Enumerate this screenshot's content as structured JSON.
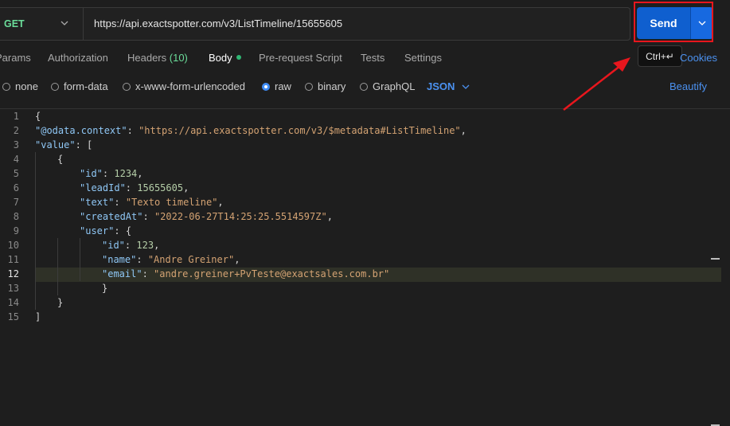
{
  "request": {
    "method": "GET",
    "url": "https://api.exactspotter.com/v3/ListTimeline/15655605",
    "send_label": "Send",
    "send_shortcut": "Ctrl+↵",
    "cookies_label": "Cookies"
  },
  "tabs": [
    {
      "label": "Params"
    },
    {
      "label": "Authorization"
    },
    {
      "label": "Headers",
      "count": "(10)"
    },
    {
      "label": "Body",
      "active": true
    },
    {
      "label": "Pre-request Script"
    },
    {
      "label": "Tests"
    },
    {
      "label": "Settings"
    }
  ],
  "body_types": [
    {
      "label": "none"
    },
    {
      "label": "form-data"
    },
    {
      "label": "x-www-form-urlencoded"
    },
    {
      "label": "raw",
      "selected": true
    },
    {
      "label": "binary"
    },
    {
      "label": "GraphQL"
    }
  ],
  "format_label": "JSON",
  "beautify_label": "Beautify",
  "editor": {
    "line_numbers": [
      "1",
      "2",
      "3",
      "4",
      "5",
      "6",
      "7",
      "8",
      "9",
      "10",
      "11",
      "12",
      "13",
      "14",
      "15"
    ],
    "current_line": "12",
    "lines": [
      "{",
      "\"@odata.context\": \"https://api.exactspotter.com/v3/$metadata#ListTimeline\",",
      "\"value\": [",
      "{",
      "\"id\": 1234,",
      "\"leadId\": 15655605,",
      "\"text\": \"Texto timeline\",",
      "\"createdAt\": \"2022-06-27T14:25:25.5514597Z\",",
      "\"user\": {",
      "\"id\": 123,",
      "\"name\": \"Andre Greiner\",",
      "\"email\": \"andre.greiner+PvTeste@exactsales.com.br\"",
      "}",
      "}",
      "]"
    ]
  },
  "colors": {
    "send_button": "#0f5fcf",
    "annotation_red": "#e8161d",
    "link_blue": "#4b91f0",
    "method_green": "#6bdd9a"
  }
}
